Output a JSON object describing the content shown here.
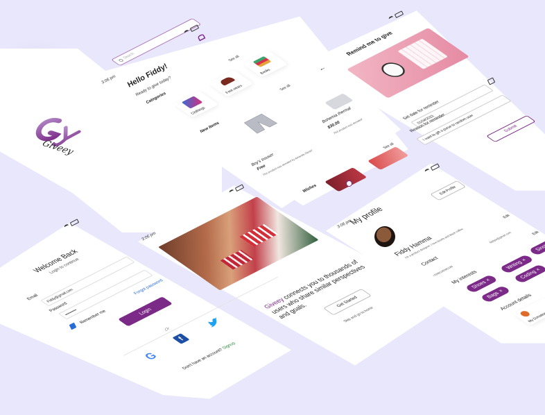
{
  "splash": {
    "brand": "Giveey"
  },
  "login": {
    "title": "Welcome Back",
    "subtitle": "Login to continue",
    "email_label": "Email",
    "email_value": "Fiddy@gmail.com",
    "password_label": "Password",
    "password_value": "••••••••••",
    "remember_label": "Remember me",
    "forgot_label": "Forgot password",
    "login_button": "Login",
    "or_label": "Or",
    "signup_prompt": "Don't have an account?",
    "signup_link": "Signup"
  },
  "home": {
    "status_time": "3:06 pm",
    "search_placeholder": "Search",
    "greeting": "Hello Fiddy!",
    "greeting_sub": "Ready to give today?",
    "categories_title": "Categories",
    "see_all_1": "See all",
    "see_all_2": "See all",
    "see_all_3": "See all",
    "categories": [
      {
        "label": "Clothings"
      },
      {
        "label": "Foot wears"
      },
      {
        "label": "Books"
      }
    ],
    "new_items_title": "New Items",
    "items": [
      {
        "name": "Boy's trouser",
        "price": "Free",
        "desc": "This product was donated by Amanda Daniel"
      },
      {
        "name": "Bohemia thermal",
        "price": "$30.00",
        "desc": "This product was donated"
      }
    ],
    "wishes_title": "Wishes"
  },
  "reminder": {
    "title": "Remind me to give",
    "date_label": "Set date for reminder",
    "date_value": "01/04/2023",
    "reason_label": "Reason for reminder",
    "reason_value": "I want to gift a purse to random user",
    "submit": "Submit"
  },
  "onboarding": {
    "status_time": "3:06 pm",
    "brand_word": "Giveey",
    "tagline": "connects you to thousands of users who share similar perspectives and goals.",
    "cta": "Get Started",
    "skip": "Skip and go to home"
  },
  "profile": {
    "status_time": "3:06 pm",
    "title": "My profile",
    "edit_profile": "Edit Profile",
    "name": "Fiddy Hamma",
    "bio": "I'm a product designer, I love books and black coffee",
    "edit_1": "Edit",
    "contact_title": "Contact",
    "edit_2": "Edit",
    "email": "fiddyw@gmail.com",
    "phone": "+2348134295188",
    "interests_title": "My interests",
    "interests": [
      "Shoes",
      "Bags",
      "Writing",
      "Coding",
      "Singing"
    ],
    "account_title": "Account details",
    "account_item": "My Donation"
  },
  "colors": {
    "accent": "#7b2a87",
    "background": "#e9e7fb"
  }
}
